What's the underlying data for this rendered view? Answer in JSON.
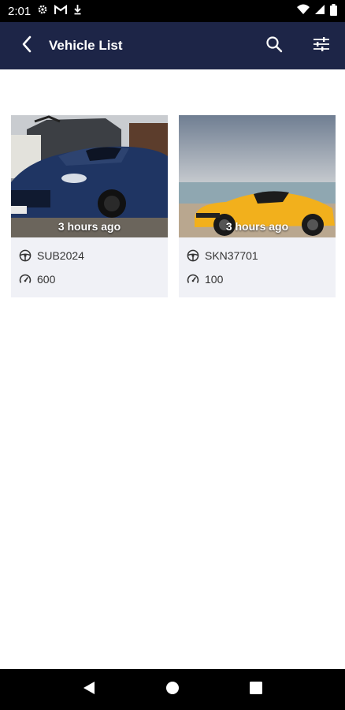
{
  "status_bar": {
    "time": "2:01",
    "icons": [
      "settings-icon",
      "gmail-icon",
      "download-icon",
      "wifi-icon",
      "signal-icon",
      "battery-icon"
    ]
  },
  "app_bar": {
    "title": "Vehicle List",
    "back_icon": "back-arrow-icon",
    "search_icon": "search-icon",
    "filter_icon": "filter-sliders-icon"
  },
  "vehicles": [
    {
      "time_ago": "3 hours ago",
      "plate": "SUB2024",
      "mileage": "600",
      "car_color": "#1f3563"
    },
    {
      "time_ago": "3 hours ago",
      "plate": "SKN37701",
      "mileage": "100",
      "car_color": "#f2b01c"
    }
  ],
  "colors": {
    "app_bar": "#1d2547",
    "card_background": "#f0f1f6"
  },
  "nav_bar": {
    "icons": [
      "back-triangle-icon",
      "home-circle-icon",
      "recents-square-icon"
    ]
  }
}
